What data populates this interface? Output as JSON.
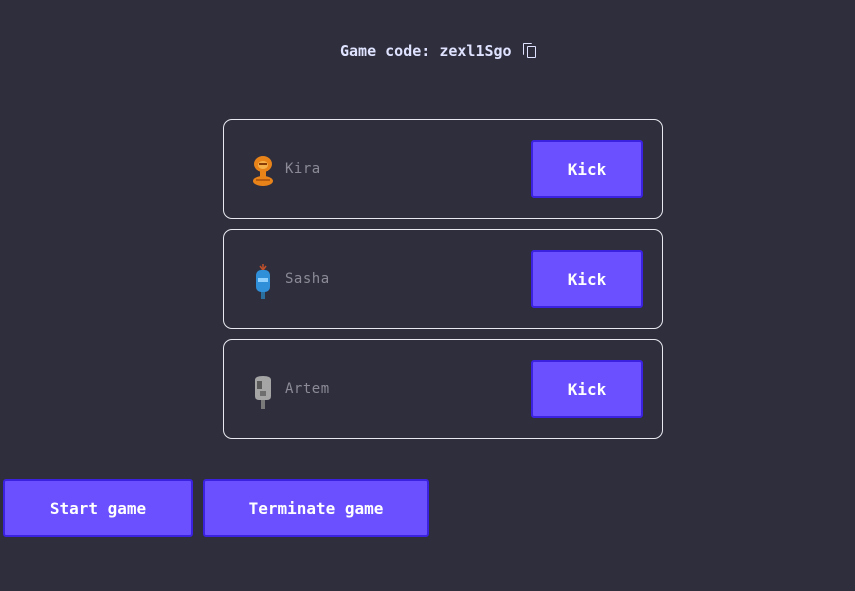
{
  "header": {
    "game_code_label": "Game code: zexl1Sgo",
    "copy_icon": "copy-icon"
  },
  "players": [
    {
      "name": "Kira",
      "kick_label": "Kick",
      "avatar": "orange-creature-avatar",
      "avatar_color": "#e8831a"
    },
    {
      "name": "Sasha",
      "kick_label": "Kick",
      "avatar": "blue-robot-avatar",
      "avatar_color": "#2f8fd8"
    },
    {
      "name": "Artem",
      "kick_label": "Kick",
      "avatar": "grey-skull-avatar",
      "avatar_color": "#9a9a9a"
    }
  ],
  "actions": {
    "start_label": "Start game",
    "terminate_label": "Terminate game"
  },
  "colors": {
    "background": "#2f2e3c",
    "button": "#6a50ff",
    "button_border": "#3a22e0",
    "card_border": "#e8e8f0",
    "player_name": "#8b8a96"
  }
}
